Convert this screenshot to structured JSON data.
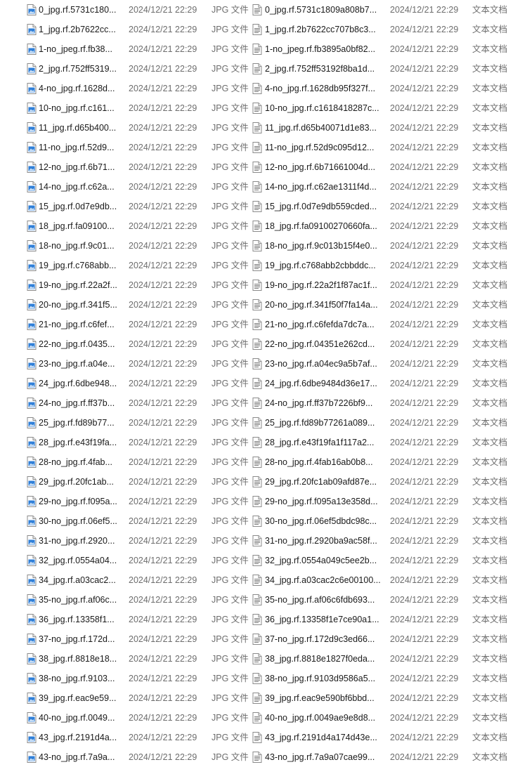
{
  "colors": {
    "jpg_icon_accent": "#2f7fd8",
    "txt_icon_accent": "#7a7a7a",
    "secondary_text": "#6d6d6d"
  },
  "icons": {
    "left_column": "jpg-file-icon",
    "right_column": "text-file-icon"
  },
  "rows": [
    {
      "jpg_name": "0_jpg.rf.5731c180...",
      "jpg_date": "2024/12/21 22:29",
      "jpg_type": "JPG 文件",
      "txt_name": "0_jpg.rf.5731c1809a808b7...",
      "txt_date": "2024/12/21 22:29",
      "txt_type": "文本文档"
    },
    {
      "jpg_name": "1_jpg.rf.2b7622cc...",
      "jpg_date": "2024/12/21 22:29",
      "jpg_type": "JPG 文件",
      "txt_name": "1_jpg.rf.2b7622cc707b8c3...",
      "txt_date": "2024/12/21 22:29",
      "txt_type": "文本文档"
    },
    {
      "jpg_name": "1-no_jpeg.rf.fb38...",
      "jpg_date": "2024/12/21 22:29",
      "jpg_type": "JPG 文件",
      "txt_name": "1-no_jpeg.rf.fb3895a0bf82...",
      "txt_date": "2024/12/21 22:29",
      "txt_type": "文本文档"
    },
    {
      "jpg_name": "2_jpg.rf.752ff5319...",
      "jpg_date": "2024/12/21 22:29",
      "jpg_type": "JPG 文件",
      "txt_name": "2_jpg.rf.752ff53192f8ba1d...",
      "txt_date": "2024/12/21 22:29",
      "txt_type": "文本文档"
    },
    {
      "jpg_name": "4-no_jpg.rf.1628d...",
      "jpg_date": "2024/12/21 22:29",
      "jpg_type": "JPG 文件",
      "txt_name": "4-no_jpg.rf.1628db95f327f...",
      "txt_date": "2024/12/21 22:29",
      "txt_type": "文本文档"
    },
    {
      "jpg_name": "10-no_jpg.rf.c161...",
      "jpg_date": "2024/12/21 22:29",
      "jpg_type": "JPG 文件",
      "txt_name": "10-no_jpg.rf.c1618418287c...",
      "txt_date": "2024/12/21 22:29",
      "txt_type": "文本文档"
    },
    {
      "jpg_name": "11_jpg.rf.d65b400...",
      "jpg_date": "2024/12/21 22:29",
      "jpg_type": "JPG 文件",
      "txt_name": "11_jpg.rf.d65b40071d1e83...",
      "txt_date": "2024/12/21 22:29",
      "txt_type": "文本文档"
    },
    {
      "jpg_name": "11-no_jpg.rf.52d9...",
      "jpg_date": "2024/12/21 22:29",
      "jpg_type": "JPG 文件",
      "txt_name": "11-no_jpg.rf.52d9c095d12...",
      "txt_date": "2024/12/21 22:29",
      "txt_type": "文本文档"
    },
    {
      "jpg_name": "12-no_jpg.rf.6b71...",
      "jpg_date": "2024/12/21 22:29",
      "jpg_type": "JPG 文件",
      "txt_name": "12-no_jpg.rf.6b71661004d...",
      "txt_date": "2024/12/21 22:29",
      "txt_type": "文本文档"
    },
    {
      "jpg_name": "14-no_jpg.rf.c62a...",
      "jpg_date": "2024/12/21 22:29",
      "jpg_type": "JPG 文件",
      "txt_name": "14-no_jpg.rf.c62ae1311f4d...",
      "txt_date": "2024/12/21 22:29",
      "txt_type": "文本文档"
    },
    {
      "jpg_name": "15_jpg.rf.0d7e9db...",
      "jpg_date": "2024/12/21 22:29",
      "jpg_type": "JPG 文件",
      "txt_name": "15_jpg.rf.0d7e9db559cded...",
      "txt_date": "2024/12/21 22:29",
      "txt_type": "文本文档"
    },
    {
      "jpg_name": "18_jpg.rf.fa09100...",
      "jpg_date": "2024/12/21 22:29",
      "jpg_type": "JPG 文件",
      "txt_name": "18_jpg.rf.fa09100270660fa...",
      "txt_date": "2024/12/21 22:29",
      "txt_type": "文本文档"
    },
    {
      "jpg_name": "18-no_jpg.rf.9c01...",
      "jpg_date": "2024/12/21 22:29",
      "jpg_type": "JPG 文件",
      "txt_name": "18-no_jpg.rf.9c013b15f4e0...",
      "txt_date": "2024/12/21 22:29",
      "txt_type": "文本文档"
    },
    {
      "jpg_name": "19_jpg.rf.c768abb...",
      "jpg_date": "2024/12/21 22:29",
      "jpg_type": "JPG 文件",
      "txt_name": "19_jpg.rf.c768abb2cbbddc...",
      "txt_date": "2024/12/21 22:29",
      "txt_type": "文本文档"
    },
    {
      "jpg_name": "19-no_jpg.rf.22a2f...",
      "jpg_date": "2024/12/21 22:29",
      "jpg_type": "JPG 文件",
      "txt_name": "19-no_jpg.rf.22a2f1f87ac1f...",
      "txt_date": "2024/12/21 22:29",
      "txt_type": "文本文档"
    },
    {
      "jpg_name": "20-no_jpg.rf.341f5...",
      "jpg_date": "2024/12/21 22:29",
      "jpg_type": "JPG 文件",
      "txt_name": "20-no_jpg.rf.341f50f7fa14a...",
      "txt_date": "2024/12/21 22:29",
      "txt_type": "文本文档"
    },
    {
      "jpg_name": "21-no_jpg.rf.c6fef...",
      "jpg_date": "2024/12/21 22:29",
      "jpg_type": "JPG 文件",
      "txt_name": "21-no_jpg.rf.c6fefda7dc7a...",
      "txt_date": "2024/12/21 22:29",
      "txt_type": "文本文档"
    },
    {
      "jpg_name": "22-no_jpg.rf.0435...",
      "jpg_date": "2024/12/21 22:29",
      "jpg_type": "JPG 文件",
      "txt_name": "22-no_jpg.rf.04351e262cd...",
      "txt_date": "2024/12/21 22:29",
      "txt_type": "文本文档"
    },
    {
      "jpg_name": "23-no_jpg.rf.a04e...",
      "jpg_date": "2024/12/21 22:29",
      "jpg_type": "JPG 文件",
      "txt_name": "23-no_jpg.rf.a04ec9a5b7af...",
      "txt_date": "2024/12/21 22:29",
      "txt_type": "文本文档"
    },
    {
      "jpg_name": "24_jpg.rf.6dbe948...",
      "jpg_date": "2024/12/21 22:29",
      "jpg_type": "JPG 文件",
      "txt_name": "24_jpg.rf.6dbe9484d36e17...",
      "txt_date": "2024/12/21 22:29",
      "txt_type": "文本文档"
    },
    {
      "jpg_name": "24-no_jpg.rf.ff37b...",
      "jpg_date": "2024/12/21 22:29",
      "jpg_type": "JPG 文件",
      "txt_name": "24-no_jpg.rf.ff37b7226bf9...",
      "txt_date": "2024/12/21 22:29",
      "txt_type": "文本文档"
    },
    {
      "jpg_name": "25_jpg.rf.fd89b77...",
      "jpg_date": "2024/12/21 22:29",
      "jpg_type": "JPG 文件",
      "txt_name": "25_jpg.rf.fd89b77261a089...",
      "txt_date": "2024/12/21 22:29",
      "txt_type": "文本文档"
    },
    {
      "jpg_name": "28_jpg.rf.e43f19fa...",
      "jpg_date": "2024/12/21 22:29",
      "jpg_type": "JPG 文件",
      "txt_name": "28_jpg.rf.e43f19fa1f117a2...",
      "txt_date": "2024/12/21 22:29",
      "txt_type": "文本文档"
    },
    {
      "jpg_name": "28-no_jpg.rf.4fab...",
      "jpg_date": "2024/12/21 22:29",
      "jpg_type": "JPG 文件",
      "txt_name": "28-no_jpg.rf.4fab16ab0b8...",
      "txt_date": "2024/12/21 22:29",
      "txt_type": "文本文档"
    },
    {
      "jpg_name": "29_jpg.rf.20fc1ab...",
      "jpg_date": "2024/12/21 22:29",
      "jpg_type": "JPG 文件",
      "txt_name": "29_jpg.rf.20fc1ab09afd87e...",
      "txt_date": "2024/12/21 22:29",
      "txt_type": "文本文档"
    },
    {
      "jpg_name": "29-no_jpg.rf.f095a...",
      "jpg_date": "2024/12/21 22:29",
      "jpg_type": "JPG 文件",
      "txt_name": "29-no_jpg.rf.f095a13e358d...",
      "txt_date": "2024/12/21 22:29",
      "txt_type": "文本文档"
    },
    {
      "jpg_name": "30-no_jpg.rf.06ef5...",
      "jpg_date": "2024/12/21 22:29",
      "jpg_type": "JPG 文件",
      "txt_name": "30-no_jpg.rf.06ef5dbdc98c...",
      "txt_date": "2024/12/21 22:29",
      "txt_type": "文本文档"
    },
    {
      "jpg_name": "31-no_jpg.rf.2920...",
      "jpg_date": "2024/12/21 22:29",
      "jpg_type": "JPG 文件",
      "txt_name": "31-no_jpg.rf.2920ba9ac58f...",
      "txt_date": "2024/12/21 22:29",
      "txt_type": "文本文档"
    },
    {
      "jpg_name": "32_jpg.rf.0554a04...",
      "jpg_date": "2024/12/21 22:29",
      "jpg_type": "JPG 文件",
      "txt_name": "32_jpg.rf.0554a049c5ee2b...",
      "txt_date": "2024/12/21 22:29",
      "txt_type": "文本文档"
    },
    {
      "jpg_name": "34_jpg.rf.a03cac2...",
      "jpg_date": "2024/12/21 22:29",
      "jpg_type": "JPG 文件",
      "txt_name": "34_jpg.rf.a03cac2c6e00100...",
      "txt_date": "2024/12/21 22:29",
      "txt_type": "文本文档"
    },
    {
      "jpg_name": "35-no_jpg.rf.af06c...",
      "jpg_date": "2024/12/21 22:29",
      "jpg_type": "JPG 文件",
      "txt_name": "35-no_jpg.rf.af06c6fdb693...",
      "txt_date": "2024/12/21 22:29",
      "txt_type": "文本文档"
    },
    {
      "jpg_name": "36_jpg.rf.13358f1...",
      "jpg_date": "2024/12/21 22:29",
      "jpg_type": "JPG 文件",
      "txt_name": "36_jpg.rf.13358f1e7ce90a1...",
      "txt_date": "2024/12/21 22:29",
      "txt_type": "文本文档"
    },
    {
      "jpg_name": "37-no_jpg.rf.172d...",
      "jpg_date": "2024/12/21 22:29",
      "jpg_type": "JPG 文件",
      "txt_name": "37-no_jpg.rf.172d9c3ed66...",
      "txt_date": "2024/12/21 22:29",
      "txt_type": "文本文档"
    },
    {
      "jpg_name": "38_jpg.rf.8818e18...",
      "jpg_date": "2024/12/21 22:29",
      "jpg_type": "JPG 文件",
      "txt_name": "38_jpg.rf.8818e1827f0eda...",
      "txt_date": "2024/12/21 22:29",
      "txt_type": "文本文档"
    },
    {
      "jpg_name": "38-no_jpg.rf.9103...",
      "jpg_date": "2024/12/21 22:29",
      "jpg_type": "JPG 文件",
      "txt_name": "38-no_jpg.rf.9103d9586a5...",
      "txt_date": "2024/12/21 22:29",
      "txt_type": "文本文档"
    },
    {
      "jpg_name": "39_jpg.rf.eac9e59...",
      "jpg_date": "2024/12/21 22:29",
      "jpg_type": "JPG 文件",
      "txt_name": "39_jpg.rf.eac9e590bf6bbd...",
      "txt_date": "2024/12/21 22:29",
      "txt_type": "文本文档"
    },
    {
      "jpg_name": "40-no_jpg.rf.0049...",
      "jpg_date": "2024/12/21 22:29",
      "jpg_type": "JPG 文件",
      "txt_name": "40-no_jpg.rf.0049ae9e8d8...",
      "txt_date": "2024/12/21 22:29",
      "txt_type": "文本文档"
    },
    {
      "jpg_name": "43_jpg.rf.2191d4a...",
      "jpg_date": "2024/12/21 22:29",
      "jpg_type": "JPG 文件",
      "txt_name": "43_jpg.rf.2191d4a174d43e...",
      "txt_date": "2024/12/21 22:29",
      "txt_type": "文本文档"
    },
    {
      "jpg_name": "43-no_jpg.rf.7a9a...",
      "jpg_date": "2024/12/21 22:29",
      "jpg_type": "JPG 文件",
      "txt_name": "43-no_jpg.rf.7a9a07cae99...",
      "txt_date": "2024/12/21 22:29",
      "txt_type": "文本文档"
    }
  ]
}
